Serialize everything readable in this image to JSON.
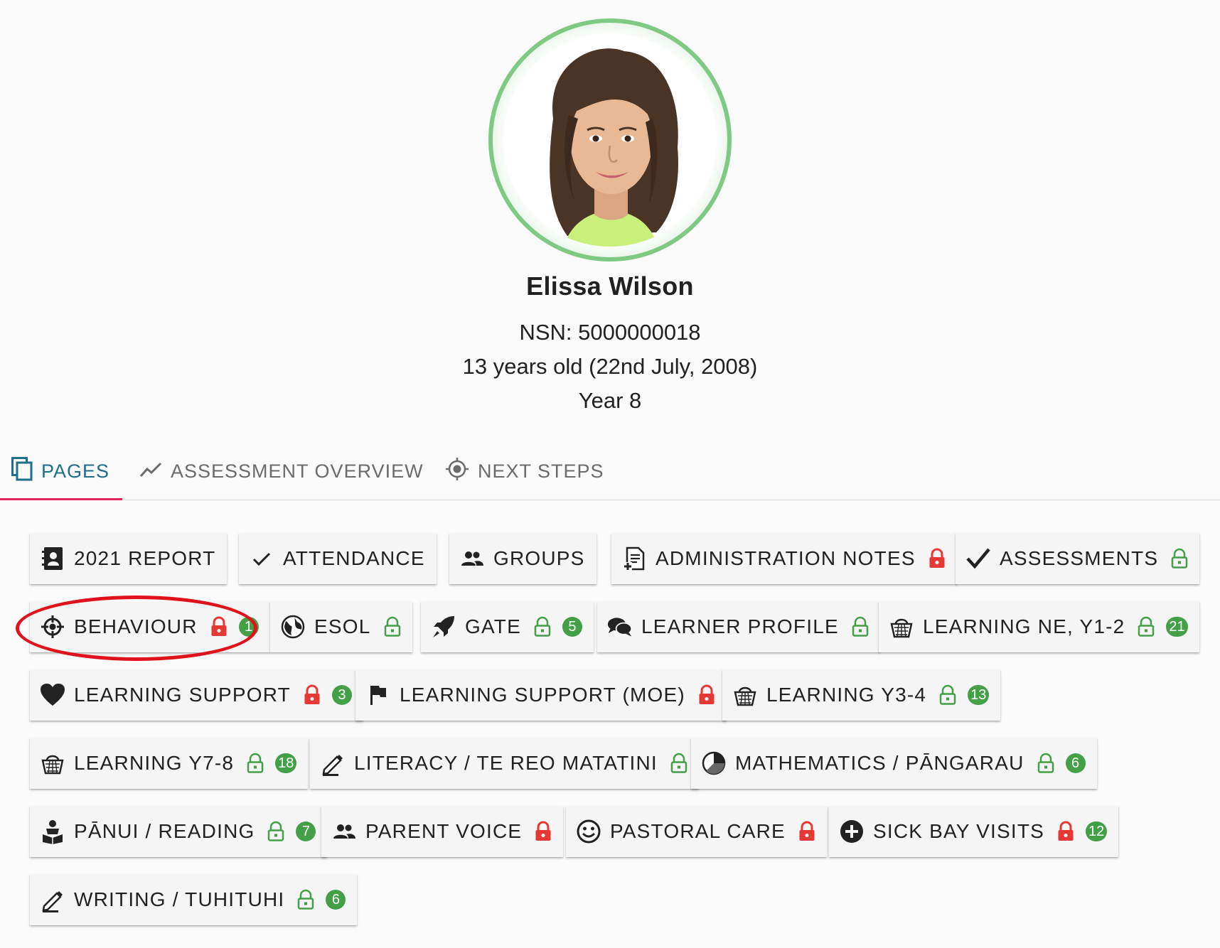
{
  "student": {
    "name": "Elissa Wilson",
    "nsn": "NSN: 5000000018",
    "age": "13 years old (22nd July, 2008)",
    "year": "Year 8"
  },
  "tabs": [
    {
      "label": "PAGES",
      "icon": "pages-icon",
      "active": true
    },
    {
      "label": "ASSESSMENT OVERVIEW",
      "icon": "trend-icon",
      "active": false
    },
    {
      "label": "NEXT STEPS",
      "icon": "target-icon",
      "active": false
    }
  ],
  "colors": {
    "accent": "#1f6f8b",
    "tab_underline": "#e2245a",
    "lock_locked": "#e53935",
    "lock_unlocked": "#43a047",
    "badge": "#43a047",
    "highlight": "#e0121b"
  },
  "pages": [
    {
      "label": "2021 REPORT",
      "icon": "contact-book-icon",
      "lock": null,
      "badge": null
    },
    {
      "label": "ATTENDANCE",
      "icon": "check-icon",
      "lock": null,
      "badge": null
    },
    {
      "label": "GROUPS",
      "icon": "people-icon",
      "lock": null,
      "badge": null
    },
    {
      "label": "ADMINISTRATION NOTES",
      "icon": "note-add-icon",
      "lock": "locked",
      "badge": null
    },
    {
      "label": "ASSESSMENTS",
      "icon": "bold-check-icon",
      "lock": "unlocked",
      "badge": null
    },
    {
      "label": "BEHAVIOUR",
      "icon": "crosshair-icon",
      "lock": "locked",
      "badge": "1"
    },
    {
      "label": "ESOL",
      "icon": "globe-icon",
      "lock": "unlocked",
      "badge": null
    },
    {
      "label": "GATE",
      "icon": "rocket-icon",
      "lock": "unlocked",
      "badge": "5"
    },
    {
      "label": "LEARNER PROFILE",
      "icon": "comments-icon",
      "lock": "unlocked",
      "badge": null
    },
    {
      "label": "LEARNING NE, Y1-2",
      "icon": "basket-icon",
      "lock": "unlocked",
      "badge": "21"
    },
    {
      "label": "LEARNING SUPPORT",
      "icon": "heart-icon",
      "lock": "locked",
      "badge": "3"
    },
    {
      "label": "LEARNING SUPPORT (MOE)",
      "icon": "flag-icon",
      "lock": "locked",
      "badge": null
    },
    {
      "label": "LEARNING Y3-4",
      "icon": "basket-icon",
      "lock": "unlocked",
      "badge": "13"
    },
    {
      "label": "LEARNING Y7-8",
      "icon": "basket-icon",
      "lock": "unlocked",
      "badge": "18"
    },
    {
      "label": "LITERACY / TE REO MATATINI",
      "icon": "pencil-icon",
      "lock": "unlocked",
      "badge": null
    },
    {
      "label": "MATHEMATICS / PĀNGARAU",
      "icon": "pie-chart-icon",
      "lock": "unlocked",
      "badge": "6"
    },
    {
      "label": "PĀNUI / READING",
      "icon": "reader-icon",
      "lock": "unlocked",
      "badge": "7"
    },
    {
      "label": "PARENT VOICE",
      "icon": "people-icon",
      "lock": "locked",
      "badge": null
    },
    {
      "label": "PASTORAL CARE",
      "icon": "smile-icon",
      "lock": "locked",
      "badge": null
    },
    {
      "label": "SICK BAY VISITS",
      "icon": "plus-circle-icon",
      "lock": "locked",
      "badge": "12"
    },
    {
      "label": "WRITING / TUHITUHI",
      "icon": "pencil-icon",
      "lock": "unlocked",
      "badge": "6"
    }
  ]
}
